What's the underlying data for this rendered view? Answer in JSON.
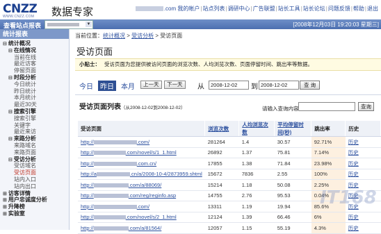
{
  "header": {
    "logo": "CNZZ",
    "logo_sub": "WWW.CNZZ.COM",
    "brand": "数据专家",
    "links": [
      ".com 我的帐户",
      "站点列表",
      "调研中心",
      "广告联盟",
      "站长工具",
      "站长论坛",
      "问题反馈",
      "帮助",
      "退出"
    ]
  },
  "bar": {
    "label": "查看站点报表",
    "date": "[2008年12月03日 19:20:03 星期三]"
  },
  "sidebar": {
    "title": "统计报表",
    "items": [
      {
        "label": "统计概况",
        "level": 0,
        "twist": "⊟"
      },
      {
        "label": "在线情况",
        "level": 1,
        "twist": "⊟"
      },
      {
        "label": "当前在线",
        "level": 2
      },
      {
        "label": "最近访客",
        "level": 2
      },
      {
        "label": "停留页面",
        "level": 2
      },
      {
        "label": "时段分析",
        "level": 1,
        "twist": "⊟"
      },
      {
        "label": "今日统计",
        "level": 2
      },
      {
        "label": "昨日统计",
        "level": 2
      },
      {
        "label": "本月统计",
        "level": 2
      },
      {
        "label": "最近30天",
        "level": 2
      },
      {
        "label": "搜索引擎",
        "level": 1,
        "twist": "⊟"
      },
      {
        "label": "搜索引擎",
        "level": 2
      },
      {
        "label": "关键字",
        "level": 2
      },
      {
        "label": "最近来访",
        "level": 2
      },
      {
        "label": "来路分析",
        "level": 1,
        "twist": "⊟"
      },
      {
        "label": "来路域名",
        "level": 2
      },
      {
        "label": "来路页面",
        "level": 2
      },
      {
        "label": "受访分析",
        "level": 1,
        "twist": "⊟"
      },
      {
        "label": "受访域名",
        "level": 2
      },
      {
        "label": "受访页面",
        "level": 2,
        "active": true
      },
      {
        "label": "站内入口",
        "level": 2
      },
      {
        "label": "站内出口",
        "level": 2
      },
      {
        "label": "访客详情",
        "level": 0,
        "twist": "⊞"
      },
      {
        "label": "用户忠诚度分析",
        "level": 0,
        "twist": "⊞"
      },
      {
        "label": "升降榜",
        "level": 0,
        "twist": "⊞"
      },
      {
        "label": "实验室",
        "level": 0,
        "twist": "⊞"
      }
    ]
  },
  "breadcrumb": {
    "prefix": "当前位置：",
    "items": [
      "统计概况",
      "受访分析",
      "受访页面"
    ],
    "sep": ">"
  },
  "page_title": "受访页面",
  "tip": {
    "label": "小贴士：",
    "text": "受访页面为您提供被访问页面的浏览次数、人均浏览次数、页面停留时间、跳出率等数据。"
  },
  "filters": {
    "today": "今日",
    "yesterday": "昨日",
    "month": "本月",
    "prev": "上一天",
    "next": "下一天",
    "from": "从",
    "to": "到",
    "start": "2008-12-02",
    "end": "2008-12-02",
    "query": "查 询"
  },
  "list": {
    "title": "受访页面列表",
    "range": "（从2008-12-02到2008-12-02）",
    "search_label": "请输入查询内容：",
    "search_btn": "查询",
    "columns": [
      "受访页面",
      "浏览次数",
      "人均浏览次数",
      "平均停留时间(秒)",
      "跳出率",
      "历史"
    ],
    "rows": [
      {
        "prefix": "http://",
        "suffix": ".com/",
        "blur": 62,
        "pv": "281264",
        "avg": "1.4",
        "time": "30.57",
        "bounce": "92.71%",
        "hist": "历史"
      },
      {
        "prefix": "http://",
        "suffix": ".com/novel/s/1_1.html",
        "blur": 46,
        "pv": "26892",
        "avg": "1.37",
        "time": "75.81",
        "bounce": "7.14%",
        "hist": "历史"
      },
      {
        "prefix": "http://",
        "suffix": ".com.cn/",
        "blur": 62,
        "pv": "17855",
        "avg": "1.38",
        "time": "71.84",
        "bounce": "23.98%",
        "hist": "历史"
      },
      {
        "prefix": "http://a",
        "suffix": ".cn/a/2008-10-4/2873959.shtml",
        "blur": 48,
        "pv": "15672",
        "avg": "7836",
        "time": "2.55",
        "bounce": "100%",
        "hist": "历史"
      },
      {
        "prefix": "http://",
        "suffix": ".com/a/88069/",
        "blur": 50,
        "pv": "15214",
        "avg": "1.18",
        "time": "50.08",
        "bounce": "2.25%",
        "hist": "历史"
      },
      {
        "prefix": "http://",
        "suffix": ".com/reg/reginfo.asp",
        "blur": 50,
        "pv": "14755",
        "avg": "2.76",
        "time": "95.53",
        "bounce": "0.04%",
        "hist": "历史"
      },
      {
        "prefix": "http://",
        "suffix": ".com/",
        "blur": 62,
        "pv": "13311",
        "avg": "1.19",
        "time": "19.94",
        "bounce": "85.6%",
        "hist": "历史"
      },
      {
        "prefix": "http://",
        "suffix": ".com/novel/s/2_1.html",
        "blur": 46,
        "pv": "12124",
        "avg": "1.39",
        "time": "66.46",
        "bounce": "6%",
        "hist": "历史"
      },
      {
        "prefix": "http://",
        "suffix": ".com/a/81564/",
        "blur": 50,
        "pv": "12057",
        "avg": "1.15",
        "time": "55.19",
        "bounce": "4.3%",
        "hist": "历史"
      }
    ]
  },
  "watermark": "IT168"
}
